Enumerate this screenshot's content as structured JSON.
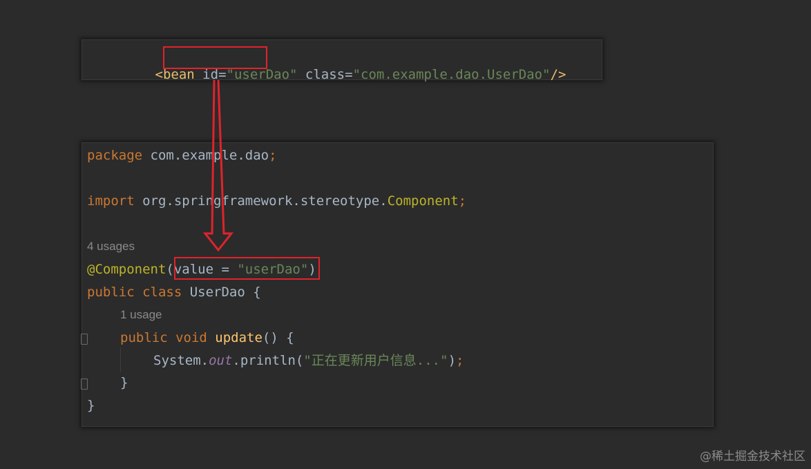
{
  "xml": {
    "indent": "    ",
    "open": "<bean ",
    "id_attr": "id",
    "eq": "=",
    "id_value": "\"userDao\"",
    "class_attr": "class",
    "class_value": "\"com.example.dao.UserDao\"",
    "close": "/>"
  },
  "java": {
    "line1": {
      "kw": "package",
      "rest": " com.example.dao",
      "semi": ";"
    },
    "line2": {
      "kw": "import",
      "rest": " org.springframework.stereotype.",
      "cls": "Component",
      "semi": ";"
    },
    "usages_class": "4 usages",
    "line3": {
      "annotation": "@Component",
      "paren_open": "(",
      "param": "value = ",
      "value": "\"userDao\"",
      "paren_close": ")"
    },
    "line4": {
      "kw": "public class",
      "rest": " UserDao {"
    },
    "usages_method": "1 usage",
    "line5": {
      "kw": "public void",
      "fn": " update",
      "rest": "() {"
    },
    "line6": {
      "obj": "System.",
      "field": "out",
      "method": ".println(",
      "str": "\"正在更新用户信息...\"",
      "close": ")",
      "semi": ";"
    },
    "line7": "}",
    "line8": "}"
  },
  "colors": {
    "highlight_box": "#e0232b",
    "arrow": "#e0232b"
  },
  "watermark": "@稀土掘金技术社区"
}
